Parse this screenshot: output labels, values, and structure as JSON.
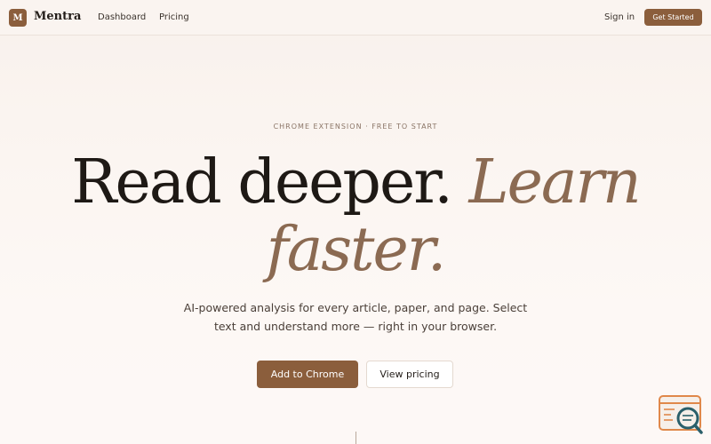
{
  "nav": {
    "logo_letter": "M",
    "brand": "Mentra",
    "links": [
      "Dashboard",
      "Pricing"
    ],
    "sign_in": "Sign in",
    "cta": "Get Started"
  },
  "hero": {
    "eyebrow": "CHROME EXTENSION · FREE TO START",
    "headline_plain": "Read deeper. ",
    "headline_accent_1": "Learn",
    "headline_accent_2": "faster.",
    "subtitle": "AI-powered analysis for every article, paper, and page. Select text and understand more — right in your browser.",
    "primary_button": "Add to Chrome",
    "secondary_button": "View pricing"
  },
  "colors": {
    "brand": "#8b5e3c",
    "accent_text": "#8b6a52",
    "widget_teal": "#2a5f6a",
    "widget_orange": "#e0884a"
  },
  "icons": {
    "floating_widget": "search-document-icon"
  }
}
